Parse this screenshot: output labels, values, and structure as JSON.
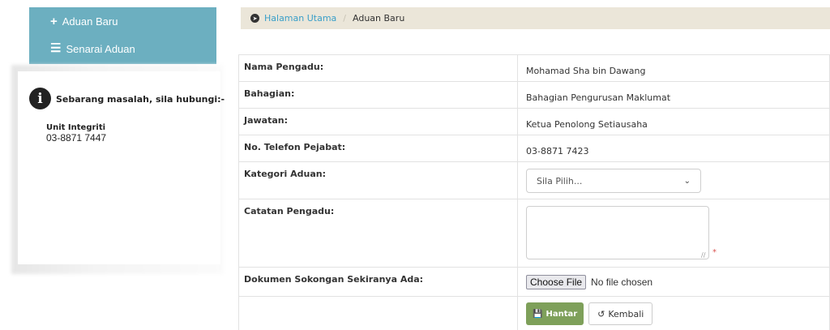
{
  "sidebar": {
    "items": [
      {
        "icon": "plus-icon",
        "label": "Aduan Baru"
      },
      {
        "icon": "list-icon",
        "label": "Senarai Aduan"
      }
    ],
    "help": {
      "text": "Sebarang masalah, sila hubungi:-",
      "unit": "Unit Integriti",
      "phone": "03-8871 7447"
    }
  },
  "breadcrumb": {
    "home": "Halaman Utama",
    "current": "Aduan Baru"
  },
  "form": {
    "name_label": "Nama Pengadu:",
    "name_value": "Mohamad Sha bin Dawang",
    "division_label": "Bahagian:",
    "division_value": "Bahagian Pengurusan Maklumat",
    "position_label": "Jawatan:",
    "position_value": "Ketua Penolong Setiausaha",
    "phone_label": "No. Telefon Pejabat:",
    "phone_value": "03-8871 7423",
    "category_label": "Kategori Aduan:",
    "category_selected": "Sila Pilih...",
    "notes_label": "Catatan Pengadu:",
    "notes_value": "",
    "document_label": "Dokumen Sokongan Sekiranya Ada:",
    "file_button": "Choose File",
    "file_status": "No file chosen",
    "submit_label": "Hantar",
    "back_label": "Kembali"
  },
  "colors": {
    "sidebar_bg": "#6cafc0",
    "breadcrumb_bg": "#ebe6d9",
    "link": "#3a9fc9",
    "submit_bg": "#7ea05a",
    "required": "#d9534f"
  }
}
